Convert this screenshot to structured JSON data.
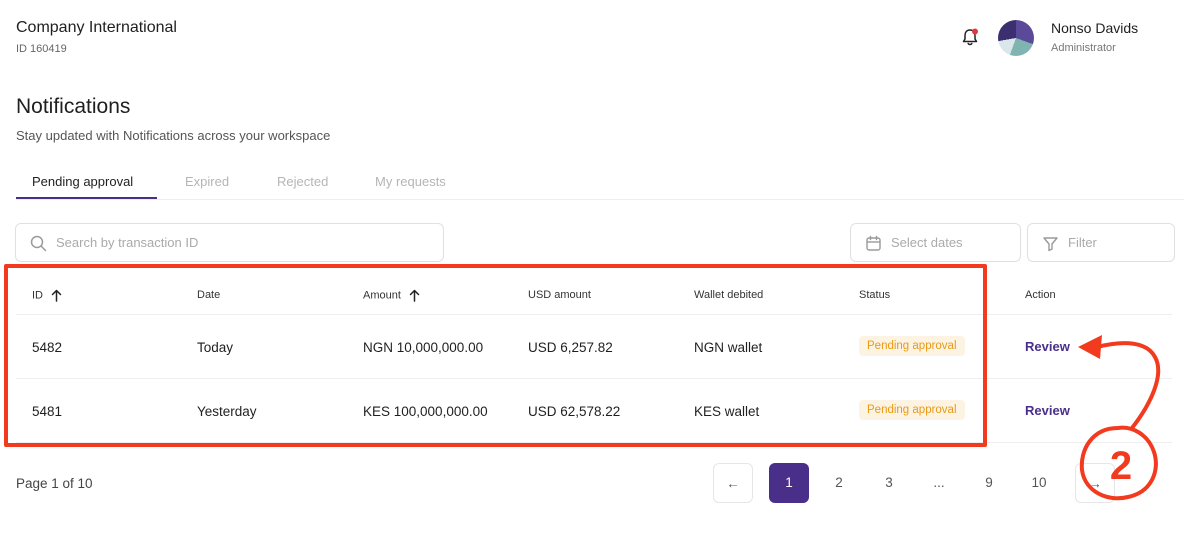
{
  "header": {
    "company_name": "Company International",
    "company_id": "ID 160419",
    "user_name": "Nonso Davids",
    "user_role": "Administrator"
  },
  "page": {
    "title": "Notifications",
    "subtitle": "Stay updated with Notifications across your workspace"
  },
  "tabs": [
    {
      "label": "Pending approval",
      "active": true
    },
    {
      "label": "Expired",
      "active": false
    },
    {
      "label": "Rejected",
      "active": false
    },
    {
      "label": "My requests",
      "active": false
    }
  ],
  "toolbar": {
    "search_placeholder": "Search by transaction ID",
    "dates_label": "Select dates",
    "filter_label": "Filter"
  },
  "table": {
    "columns": [
      "ID",
      "Date",
      "Amount",
      "USD amount",
      "Wallet debited",
      "Status",
      "Action"
    ],
    "rows": [
      {
        "id": "5482",
        "date": "Today",
        "amount": "NGN 10,000,000.00",
        "usd_amount": "USD 6,257.82",
        "wallet": "NGN wallet",
        "status": "Pending approval",
        "action": "Review"
      },
      {
        "id": "5481",
        "date": "Yesterday",
        "amount": "KES 100,000,000.00",
        "usd_amount": "USD 62,578.22",
        "wallet": "KES wallet",
        "status": "Pending approval",
        "action": "Review"
      }
    ]
  },
  "pagination": {
    "info": "Page 1 of 10",
    "prev": "←",
    "pages": [
      "1",
      "2",
      "3",
      "...",
      "9",
      "10"
    ],
    "current": "1",
    "next": "→"
  },
  "annotation": {
    "step_number": "2"
  },
  "colors": {
    "brand": "#4a2f8a",
    "pending": "#e89a17",
    "annotation": "#f23a1e",
    "notification_dot": "#e5383b"
  }
}
